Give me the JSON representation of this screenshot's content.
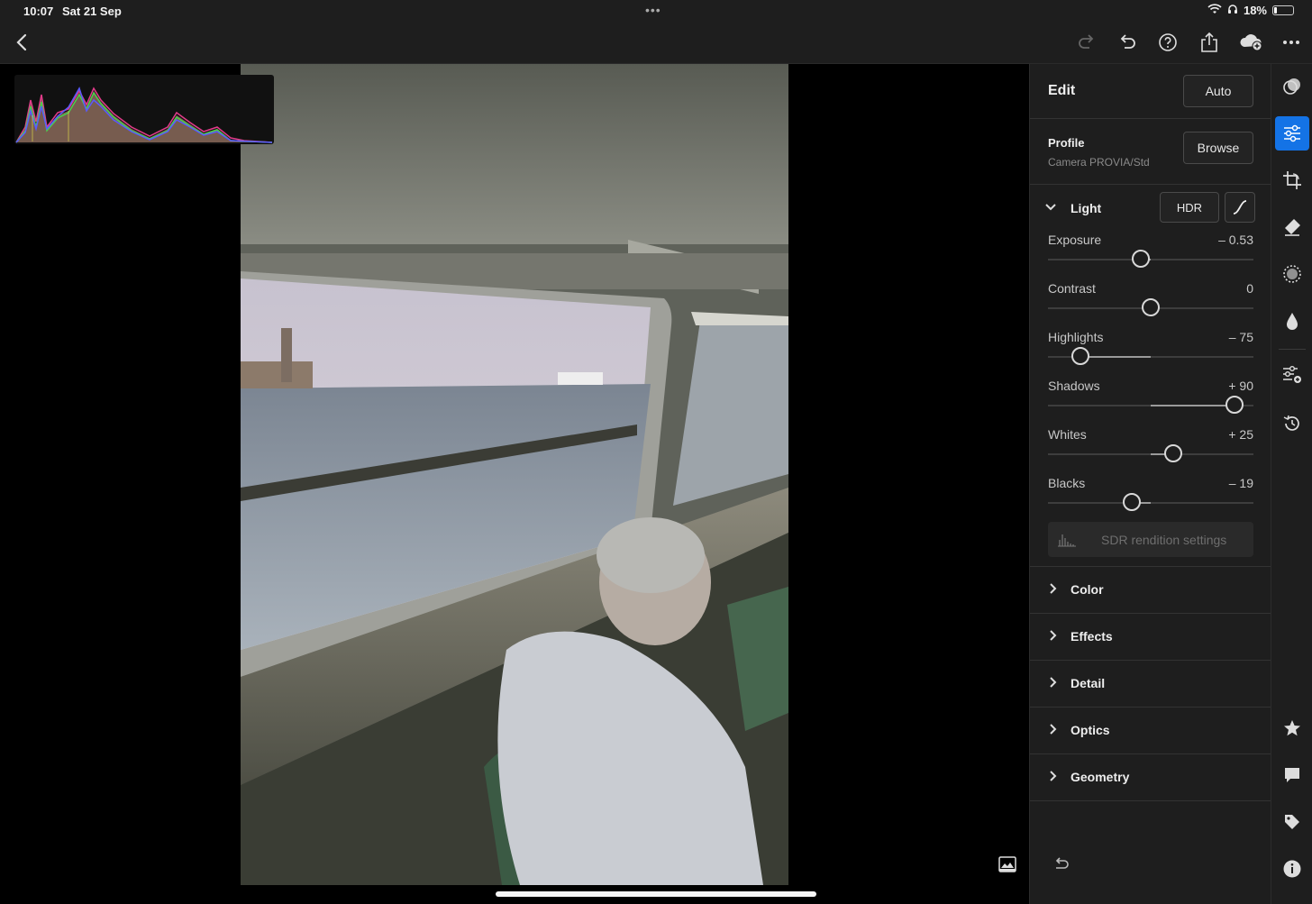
{
  "status_bar": {
    "time": "10:07",
    "date": "Sat 21 Sep",
    "dots": "•••",
    "battery": "18%",
    "battery_level": 0.18
  },
  "toolbar": {
    "back_icon": "chevron-left-icon",
    "redo_icon": "redo-icon",
    "undo_icon": "undo-icon",
    "help_icon": "help-icon",
    "share_icon": "share-icon",
    "cloud_icon": "cloud-add-icon",
    "more_icon": "more-icon"
  },
  "edit_panel": {
    "title": "Edit",
    "auto_label": "Auto",
    "profile": {
      "label": "Profile",
      "value": "Camera PROVIA/Std",
      "browse_label": "Browse"
    },
    "light": {
      "label": "Light",
      "hdr_label": "HDR",
      "sliders": [
        {
          "name": "exposure",
          "label": "Exposure",
          "value": "– 0.53",
          "position": 0.45,
          "center": 0.5
        },
        {
          "name": "contrast",
          "label": "Contrast",
          "value": "0",
          "position": 0.5,
          "center": 0.5
        },
        {
          "name": "highlights",
          "label": "Highlights",
          "value": "– 75",
          "position": 0.16,
          "center": 0.5
        },
        {
          "name": "shadows",
          "label": "Shadows",
          "value": "+ 90",
          "position": 0.91,
          "center": 0.5
        },
        {
          "name": "whites",
          "label": "Whites",
          "value": "+ 25",
          "position": 0.61,
          "center": 0.5
        },
        {
          "name": "blacks",
          "label": "Blacks",
          "value": "– 19",
          "position": 0.41,
          "center": 0.5
        }
      ],
      "sdr_label": "SDR rendition settings"
    },
    "sections": [
      {
        "name": "color",
        "label": "Color"
      },
      {
        "name": "effects",
        "label": "Effects"
      },
      {
        "name": "detail",
        "label": "Detail"
      },
      {
        "name": "optics",
        "label": "Optics"
      },
      {
        "name": "geometry",
        "label": "Geometry"
      }
    ]
  },
  "rail": {
    "icons": [
      "presets-icon",
      "adjust-icon",
      "crop-icon",
      "eraser-icon",
      "masking-icon",
      "blur-icon",
      "versions-icon",
      "history-icon",
      "star-icon",
      "comment-icon",
      "tag-icon",
      "info-icon"
    ],
    "active": "adjust-icon"
  },
  "colors": {
    "accent": "#1473e6",
    "panel_bg": "#1e1e1e"
  }
}
